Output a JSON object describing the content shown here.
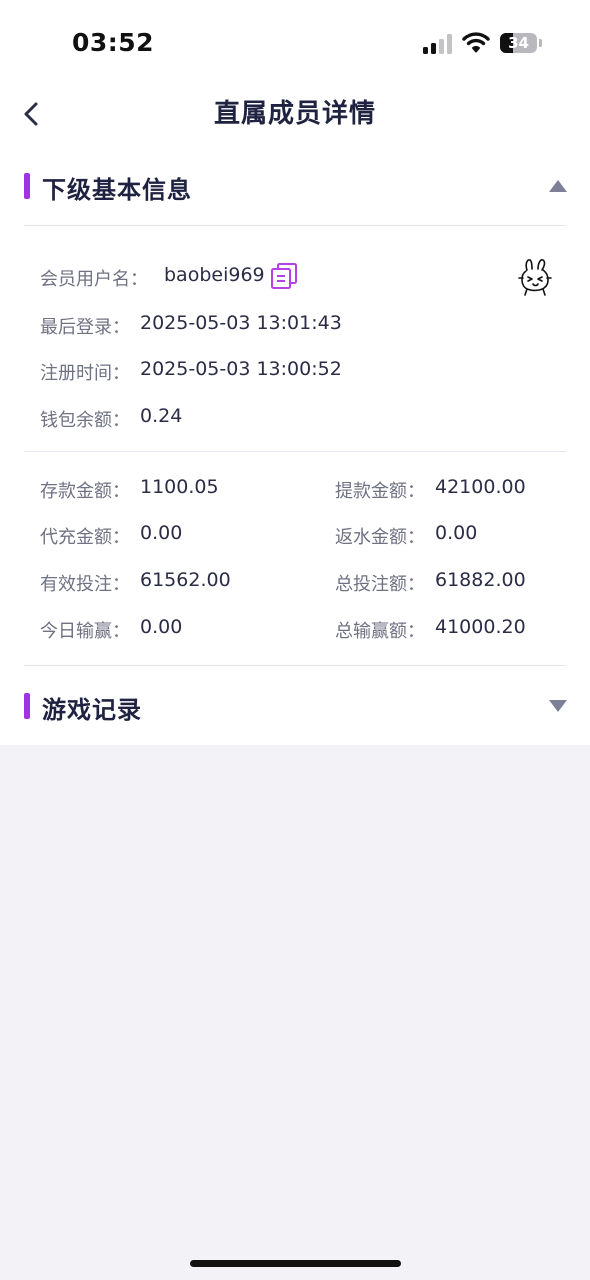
{
  "status_bar": {
    "time": "03:52",
    "battery": "34",
    "battery_level": 0.34
  },
  "nav": {
    "title": "直属成员详情",
    "back_icon": "chevron-left-icon"
  },
  "basic_info": {
    "section_title": "下级基本信息",
    "toggle_icon": "triangle-up-icon",
    "username_label": "会员用户名：",
    "username": "baobei969",
    "copy_icon": "copy-icon",
    "last_login_label": "最后登录：",
    "last_login": "2025-05-03 13:01:43",
    "register_label": "注册时间：",
    "register_time": "2025-05-03 13:00:52",
    "wallet_label": "钱包余额：",
    "wallet_balance": "0.24"
  },
  "stats": {
    "deposit_label": "存款金额：",
    "deposit": "1100.05",
    "withdraw_label": "提款金额：",
    "withdraw": "42100.00",
    "proxy_recharge_label": "代充金额：",
    "proxy_recharge": "0.00",
    "rebate_label": "返水金额：",
    "rebate": "0.00",
    "valid_bet_label": "有效投注：",
    "valid_bet": "61562.00",
    "total_bet_label": "总投注额：",
    "total_bet": "61882.00",
    "today_win_label": "今日输赢：",
    "today_win": "0.00",
    "total_win_label": "总输赢额：",
    "total_win": "41000.20"
  },
  "game_records": {
    "section_title": "游戏记录",
    "toggle_icon": "triangle-down-icon"
  },
  "colors": {
    "accent": "#a033e6",
    "title_text": "#1f2240",
    "label_text": "#6f7283",
    "value_text": "#2a2d45",
    "page_background": "#f2f2f7"
  }
}
